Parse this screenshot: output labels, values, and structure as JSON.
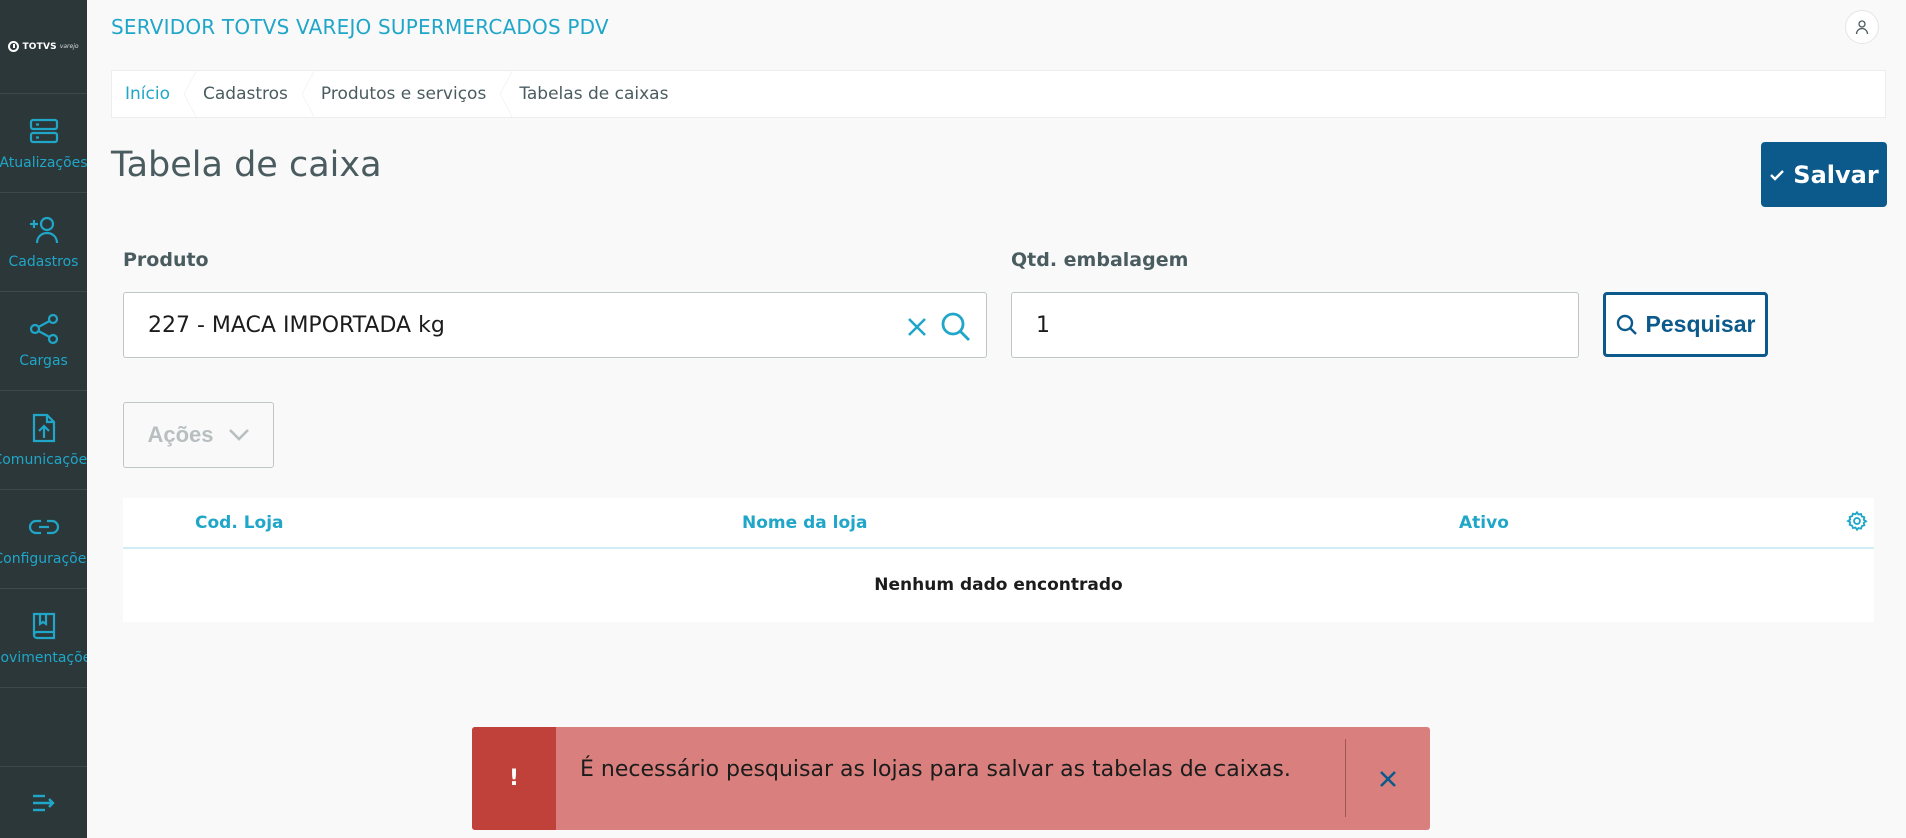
{
  "app": {
    "title": "SERVIDOR TOTVS VAREJO SUPERMERCADOS PDV",
    "logo_text": "TOTVS",
    "logo_sub": "varejo"
  },
  "sidebar": {
    "items": [
      {
        "label": "Atualizações",
        "icon": "server-icon"
      },
      {
        "label": "Cadastros",
        "icon": "add-user-icon"
      },
      {
        "label": "Cargas",
        "icon": "share-icon"
      },
      {
        "label": "Comunicações",
        "icon": "file-upload-icon"
      },
      {
        "label": "Configurações",
        "icon": "link-icon"
      },
      {
        "label": "Movimentações",
        "icon": "book-icon"
      }
    ],
    "toggle_icon": "menu-collapse-icon"
  },
  "breadcrumb": [
    "Início",
    "Cadastros",
    "Produtos e serviços",
    "Tabelas de caixas"
  ],
  "page": {
    "title": "Tabela de caixa",
    "save_label": "Salvar"
  },
  "form": {
    "product_label": "Produto",
    "product_value": "227 - MACA IMPORTADA kg",
    "qty_label": "Qtd. embalagem",
    "qty_value": "1",
    "search_label": "Pesquisar",
    "actions_label": "Ações"
  },
  "table": {
    "columns": [
      "Cod. Loja",
      "Nome da loja",
      "Ativo"
    ],
    "empty_text": "Nenhum dado encontrado",
    "rows": []
  },
  "toast": {
    "type": "error",
    "icon_text": "!",
    "message": "É necessário pesquisar as lojas para salvar as tabelas de caixas."
  },
  "colors": {
    "sidebar_bg": "#2c3739",
    "accent": "#1fa6c8",
    "primary": "#0c5a8c",
    "error_dark": "#c0403a",
    "error_light": "#d9807e"
  }
}
